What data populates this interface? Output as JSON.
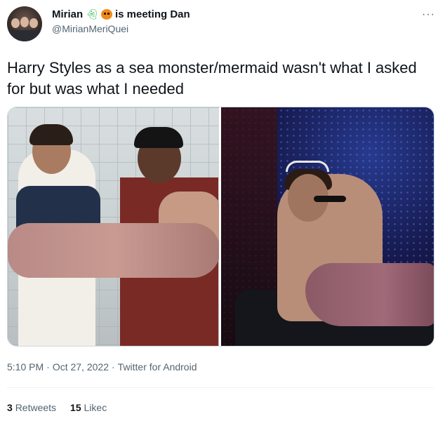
{
  "author": {
    "display_name": "Mirian",
    "status": "is meeting Dan",
    "handle": "@MirianMeriQuei",
    "emojis": [
      "ghost-emoji",
      "pumpkin-emoji"
    ]
  },
  "tweet": {
    "text": "Harry Styles as a sea monster/mermaid wasn't what I asked for but was what I needed",
    "time": "5:10 PM",
    "date": "Oct 27, 2022",
    "source": "Twitter for Android",
    "separator": "·"
  },
  "stats": {
    "retweets_count": "3",
    "retweets_label": "Retweets",
    "likes_count": "15",
    "likes_label": "Likeс"
  },
  "icons": {
    "more": "more-options-icon"
  },
  "colors": {
    "text_primary": "#0f1419",
    "text_secondary": "#536471",
    "divider": "#eff3f4"
  }
}
